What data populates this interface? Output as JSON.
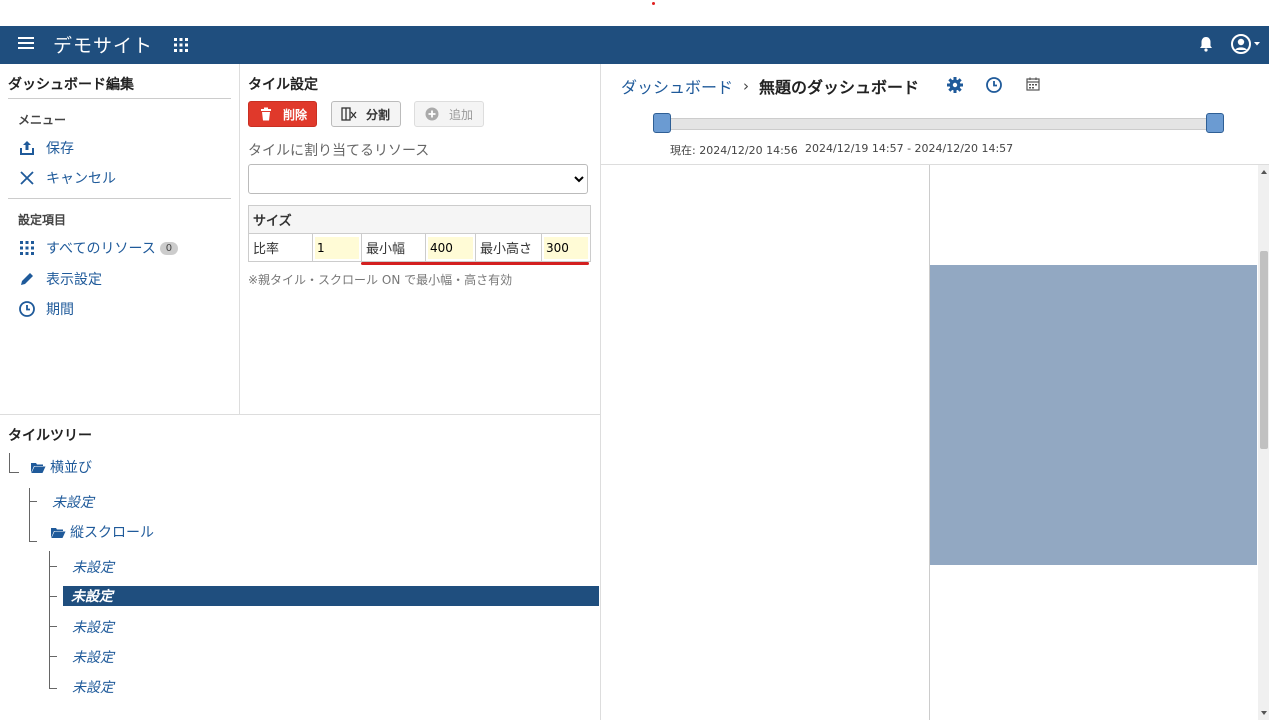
{
  "navbar": {
    "title": "デモサイト"
  },
  "left_panel": {
    "title": "ダッシュボード編集",
    "menu_label": "メニュー",
    "save_label": "保存",
    "cancel_label": "キャンセル",
    "settings_label": "設定項目",
    "all_resources_label": "すべてのリソース",
    "all_resources_count": "0",
    "display_settings_label": "表示設定",
    "period_label": "期間"
  },
  "tile_settings": {
    "title": "タイル設定",
    "delete_label": "削除",
    "split_label": "分割",
    "add_label": "追加",
    "resource_label": "タイルに割り当てるリソース",
    "resource_value": "",
    "size_header": "サイズ",
    "ratio_label": "比率",
    "ratio_value": "1",
    "min_width_label": "最小幅",
    "min_width_value": "400",
    "min_height_label": "最小高さ",
    "min_height_value": "300",
    "note": "※親タイル・スクロール ON で最小幅・高さ有効"
  },
  "tile_tree": {
    "title": "タイルツリー",
    "root_label": "横並び",
    "child1_label": "未設定",
    "child2_label": "縦スクロール",
    "leaves": [
      "未設定",
      "未設定",
      "未設定",
      "未設定",
      "未設定"
    ],
    "selected_index": 1
  },
  "dashboard": {
    "breadcrumb_root": "ダッシュボード",
    "breadcrumb_current": "無題のダッシュボード",
    "current_time": "現在: 2024/12/20 14:56",
    "time_range": "2024/12/19 14:57 - 2024/12/20 14:57"
  },
  "colors": {
    "navbar": "#1f4e7e",
    "link": "#1f5a9a",
    "danger": "#e0392b",
    "tile": "#92a8c2",
    "input_highlight": "#fffbd6"
  }
}
